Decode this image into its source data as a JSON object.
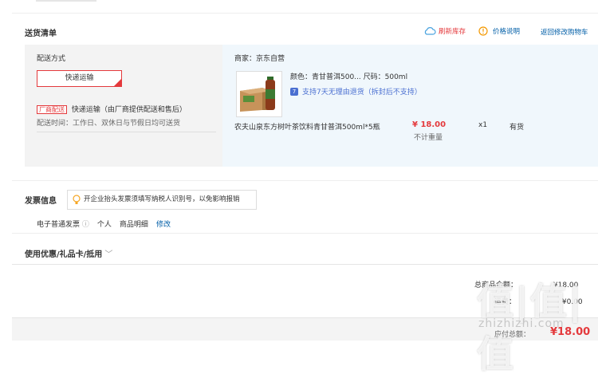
{
  "delivery": {
    "title": "送货清单",
    "refresh_stock": "刷新库存",
    "price_info": "价格说明",
    "back_to_cart": "返回修改购物车",
    "method_label": "配送方式",
    "method_value": "快递运输",
    "vendor_tag": "厂商配送",
    "vendor_desc": "快递运输（由厂商提供配送和售后）",
    "delivery_time": "配送时间：工作日、双休日与节假日均可送货",
    "seller": "商家：京东自营",
    "item": {
      "color_size": "颜色：青甘普洱500...  尺码：500ml",
      "return_badge": "支持7天无理由退货（拆封后不支持）",
      "name": "农夫山泉东方树叶茶饮料青甘普洱500ml*5瓶",
      "price": "¥ 18.00",
      "weight_note": "不计重量",
      "qty": "x1",
      "stock": "有货"
    }
  },
  "invoice": {
    "title": "发票信息",
    "tip": "开企业抬头发票须填写纳税人识别号，以免影响报销",
    "type": "电子普通发票",
    "info_icon": "ⓘ",
    "holder": "个人",
    "content": "商品明细",
    "modify": "修改"
  },
  "coupon": {
    "title": "使用优惠/礼品卡/抵用",
    "chevron": "﹀"
  },
  "summary": {
    "row1_label": "总商品金额：",
    "row1_value": "¥18.00",
    "row2_label": "运费：",
    "row2_value": "¥0.00",
    "total_label": "应付总额：",
    "total_value": "¥18.00"
  },
  "watermark": {
    "logo": "值|值|值",
    "site": "zhizhizhi.com"
  },
  "colors": {
    "brand_red": "#e4393c",
    "link_blue": "#005ea7",
    "panel_blue": "#f0f7fc"
  }
}
